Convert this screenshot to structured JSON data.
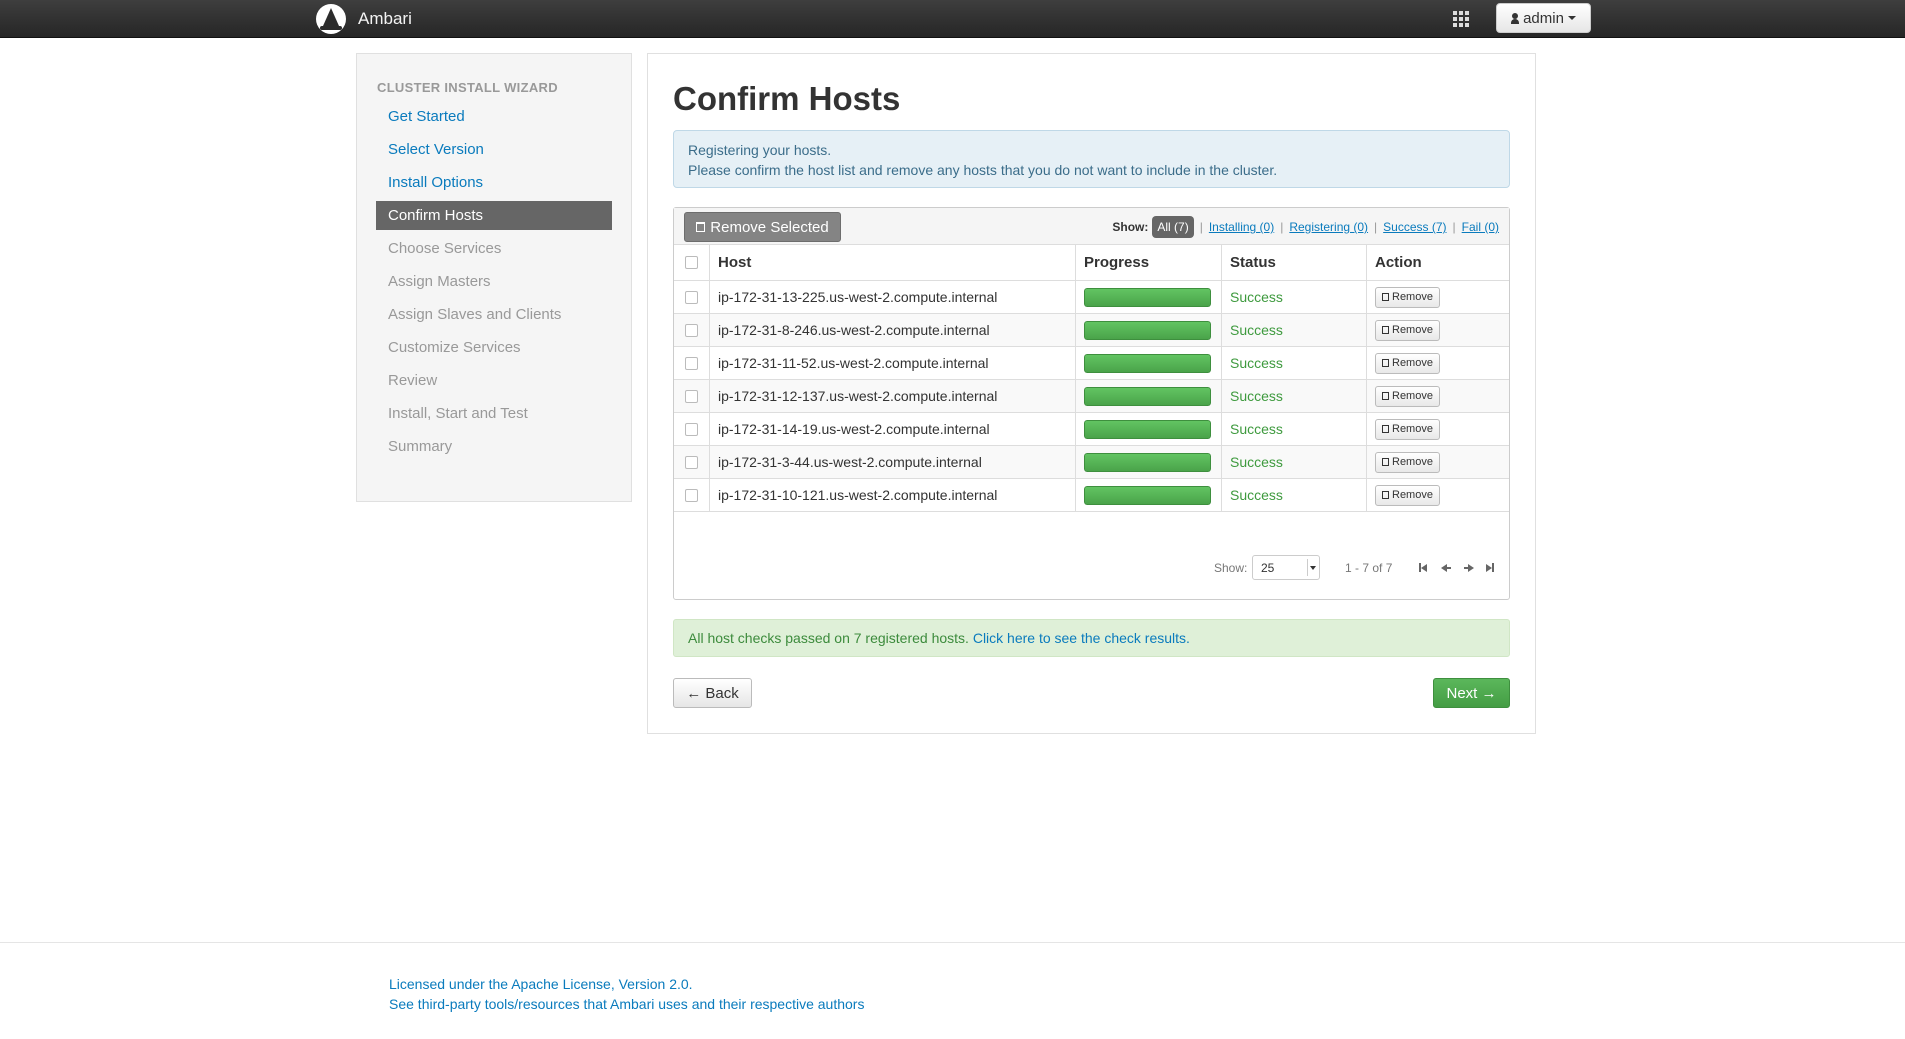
{
  "navbar": {
    "brand": "Ambari",
    "user_button": "admin",
    "icons": {
      "logo": "ambari-logo-icon",
      "apps": "grid-apps-icon",
      "user": "user-icon"
    }
  },
  "wizard": {
    "title": "CLUSTER INSTALL WIZARD",
    "steps": [
      {
        "label": "Get Started",
        "state": "done"
      },
      {
        "label": "Select Version",
        "state": "done"
      },
      {
        "label": "Install Options",
        "state": "done"
      },
      {
        "label": "Confirm Hosts",
        "state": "active"
      },
      {
        "label": "Choose Services",
        "state": "todo"
      },
      {
        "label": "Assign Masters",
        "state": "todo"
      },
      {
        "label": "Assign Slaves and Clients",
        "state": "todo"
      },
      {
        "label": "Customize Services",
        "state": "todo"
      },
      {
        "label": "Review",
        "state": "todo"
      },
      {
        "label": "Install, Start and Test",
        "state": "todo"
      },
      {
        "label": "Summary",
        "state": "todo"
      }
    ]
  },
  "main": {
    "title": "Confirm Hosts",
    "info_line1": "Registering your hosts.",
    "info_line2": "Please confirm the host list and remove any hosts that you do not want to include in the cluster.",
    "remove_selected": "Remove Selected",
    "filters": {
      "show_label": "Show:",
      "all": "All (7)",
      "installing": "Installing (0)",
      "registering": "Registering (0)",
      "success": "Success (7)",
      "fail": "Fail (0)"
    },
    "columns": {
      "host": "Host",
      "progress": "Progress",
      "status": "Status",
      "action": "Action"
    },
    "hosts": [
      {
        "host": "ip-172-31-13-225.us-west-2.compute.internal",
        "progress": 1.0,
        "status": "Success",
        "action": "Remove"
      },
      {
        "host": "ip-172-31-8-246.us-west-2.compute.internal",
        "progress": 1.0,
        "status": "Success",
        "action": "Remove"
      },
      {
        "host": "ip-172-31-11-52.us-west-2.compute.internal",
        "progress": 1.0,
        "status": "Success",
        "action": "Remove"
      },
      {
        "host": "ip-172-31-12-137.us-west-2.compute.internal",
        "progress": 1.0,
        "status": "Success",
        "action": "Remove"
      },
      {
        "host": "ip-172-31-14-19.us-west-2.compute.internal",
        "progress": 1.0,
        "status": "Success",
        "action": "Remove"
      },
      {
        "host": "ip-172-31-3-44.us-west-2.compute.internal",
        "progress": 1.0,
        "status": "Success",
        "action": "Remove"
      },
      {
        "host": "ip-172-31-10-121.us-west-2.compute.internal",
        "progress": 1.0,
        "status": "Success",
        "action": "Remove"
      }
    ],
    "pager": {
      "show_label": "Show:",
      "page_size": "25",
      "range": "1 - 7 of 7"
    },
    "check_text": "All host checks passed on 7 registered hosts.",
    "check_link": "Click here to see the check results.",
    "back_button": "← Back",
    "next_button": "Next →"
  },
  "footer": {
    "license": "Licensed under the Apache License, Version 2.0.",
    "third_party": "See third-party tools/resources that Ambari uses and their respective authors"
  },
  "colors": {
    "navbar": "#2f2f2f",
    "link": "#0a7bbd",
    "success": "#3e9a3e",
    "progress_fill": "#55b055",
    "active_step": "#666666",
    "next_button": "#51a351"
  }
}
